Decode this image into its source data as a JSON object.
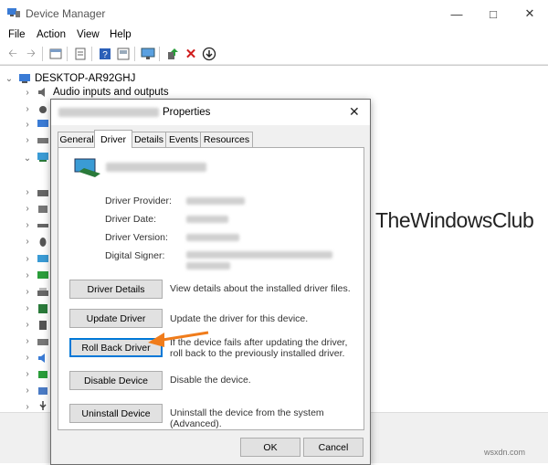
{
  "window": {
    "title": "Device Manager"
  },
  "menu": [
    "File",
    "Action",
    "View",
    "Help"
  ],
  "tree": {
    "root": "DESKTOP-AR92GHJ",
    "first_child": "Audio inputs and outputs"
  },
  "dialog": {
    "title_suffix": "Properties",
    "tabs": [
      "General",
      "Driver",
      "Details",
      "Events",
      "Resources"
    ],
    "active_tab": "Driver",
    "fields": [
      {
        "label": "Driver Provider:"
      },
      {
        "label": "Driver Date:"
      },
      {
        "label": "Driver Version:"
      },
      {
        "label": "Digital Signer:"
      }
    ],
    "actions": [
      {
        "button": "Driver Details",
        "desc": "View details about the installed driver files."
      },
      {
        "button": "Update Driver",
        "desc": "Update the driver for this device."
      },
      {
        "button": "Roll Back Driver",
        "desc": "If the device fails after updating the driver, roll back to the previously installed driver."
      },
      {
        "button": "Disable Device",
        "desc": "Disable the device."
      },
      {
        "button": "Uninstall Device",
        "desc": "Uninstall the device from the system (Advanced)."
      }
    ],
    "ok_label": "OK",
    "cancel_label": "Cancel"
  },
  "watermark": {
    "text": "TheWindowsClub",
    "credit": "wsxdn.com"
  },
  "colors": {
    "accent": "#0078d7",
    "arrow": "#f07c1b",
    "logo_blue": "#1a8fd4"
  },
  "icons": [
    "device-manager-icon",
    "back-arrow-icon",
    "forward-arrow-icon",
    "properties-icon",
    "help-icon",
    "scan-icon",
    "add-driver-icon",
    "uninstall-x-icon",
    "download-icon",
    "monitor-icon",
    "network-adapter-icon",
    "close-icon"
  ]
}
